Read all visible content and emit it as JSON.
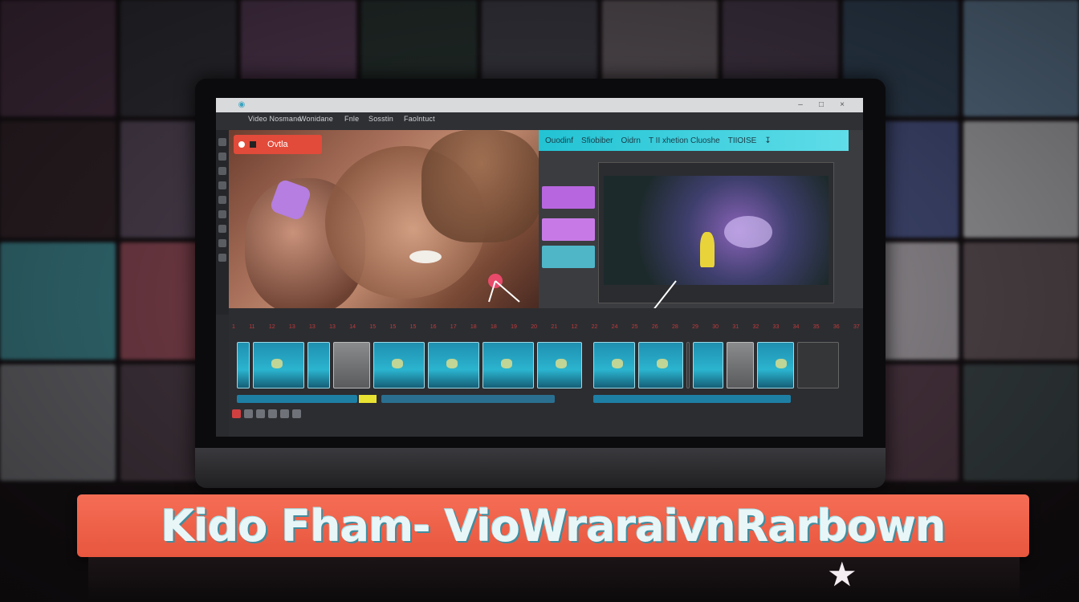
{
  "colors": {
    "accent_cyan": "#22c3d4",
    "record_red": "#e24a3a",
    "banner_orange": "#f0624a",
    "banner_text": "#e9f6f7"
  },
  "app": {
    "menu_items": [
      "Video Nosmane",
      "Wonidane",
      "Fnle",
      "Sosstin",
      "Faolntuct"
    ],
    "record_label": "Ovtla",
    "panel_bar_items": [
      "Ouodinf",
      "Sfiobiber",
      "Oidrn",
      "T II xhetion Cluoshe",
      "TIIOISE"
    ],
    "ruler_ticks": [
      "1",
      "11",
      "12",
      "13",
      "13",
      "13",
      "14",
      "15",
      "15",
      "15",
      "16",
      "17",
      "18",
      "18",
      "19",
      "20",
      "21",
      "12",
      "22",
      "24",
      "25",
      "26",
      "28",
      "29",
      "30",
      "31",
      "32",
      "33",
      "34",
      "35",
      "36",
      "37"
    ]
  },
  "banner": {
    "text": "Kido Fham- VioWraraivnRarbown"
  },
  "icons": {
    "record": "record-dot-icon",
    "stop": "stop-icon",
    "cursor": "arrow-cursor-icon",
    "star": "star-icon"
  }
}
